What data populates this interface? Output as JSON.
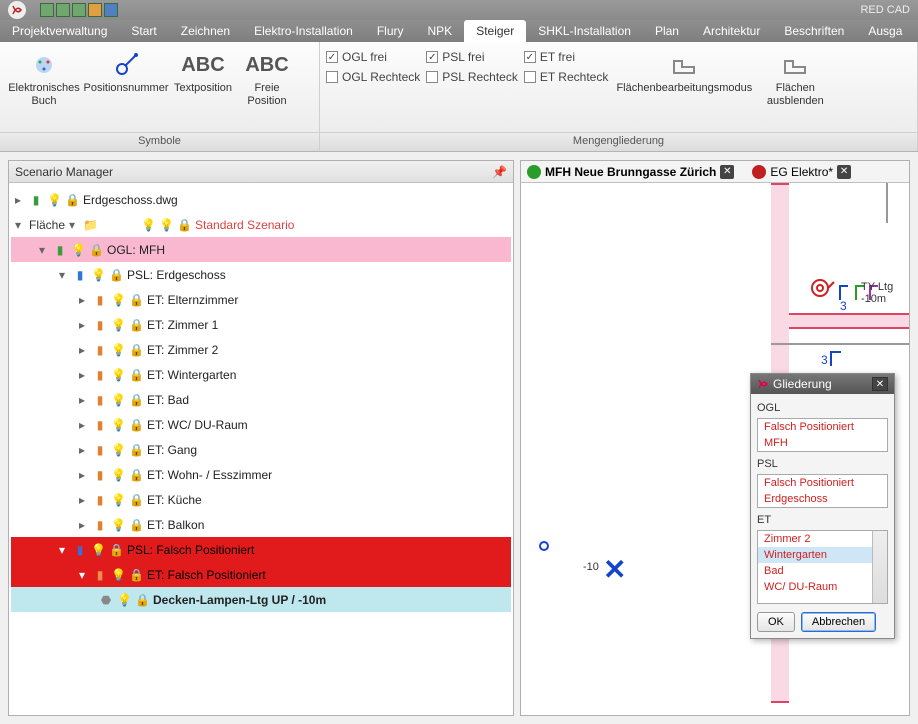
{
  "app": {
    "title": "RED CAD"
  },
  "menubar": {
    "items": [
      "Projektverwaltung",
      "Start",
      "Zeichnen",
      "Elektro-Installation",
      "Flury",
      "NPK",
      "Steiger",
      "SHKL-Installation",
      "Plan",
      "Architektur",
      "Beschriften",
      "Ausga"
    ],
    "active": 6
  },
  "ribbon": {
    "symbole": {
      "label": "Symbole",
      "buttons": {
        "ebook": "Elektronisches\nBuch",
        "posnr": "Positionsnummer",
        "textpos": "Textposition",
        "freepos": "Freie\nPosition"
      }
    },
    "mengen": {
      "label": "Mengengliederung",
      "ogl_frei": "OGL frei",
      "ogl_rect": "OGL Rechteck",
      "psl_frei": "PSL frei",
      "psl_rect": "PSL Rechteck",
      "et_frei": "ET frei",
      "et_rect": "ET Rechteck",
      "modus": "Flächenbearbeitungsmodus",
      "ausbl": "Flächen\nausblenden"
    }
  },
  "scenario": {
    "title": "Scenario Manager",
    "root": "Erdgeschoss.dwg",
    "flaeche": "Fläche",
    "standard": "Standard Szenario",
    "ogl": "OGL: MFH",
    "psl": "PSL: Erdgeschoss",
    "rooms": [
      "ET: Elternzimmer",
      "ET: Zimmer 1",
      "ET: Zimmer 2",
      "ET: Wintergarten",
      "ET: Bad",
      "ET: WC/ DU-Raum",
      "ET: Gang",
      "ET: Wohn- / Esszimmer",
      "ET: Küche",
      "ET: Balkon"
    ],
    "psl_fp": "PSL: Falsch Positioniert",
    "et_fp": "ET: Falsch Positioniert",
    "item": "Decken-Lampen-Ltg UP / -10m"
  },
  "drawtabs": {
    "a": "MFH Neue Brunngasse Zürich",
    "b": "EG Elektro*"
  },
  "canvas": {
    "marker_label": "-10",
    "ltg_label": "TY Ltg -10m",
    "sub_label": "3"
  },
  "gliederung": {
    "title": "Gliederung",
    "ogl_label": "OGL",
    "ogl_items": [
      "Falsch Positioniert",
      "MFH"
    ],
    "psl_label": "PSL",
    "psl_items": [
      "Falsch Positioniert",
      "Erdgeschoss"
    ],
    "et_label": "ET",
    "et_items": [
      "Zimmer 2",
      "Wintergarten",
      "Bad",
      "WC/ DU-Raum"
    ],
    "et_selected": 1,
    "ok": "OK",
    "cancel": "Abbrechen"
  }
}
